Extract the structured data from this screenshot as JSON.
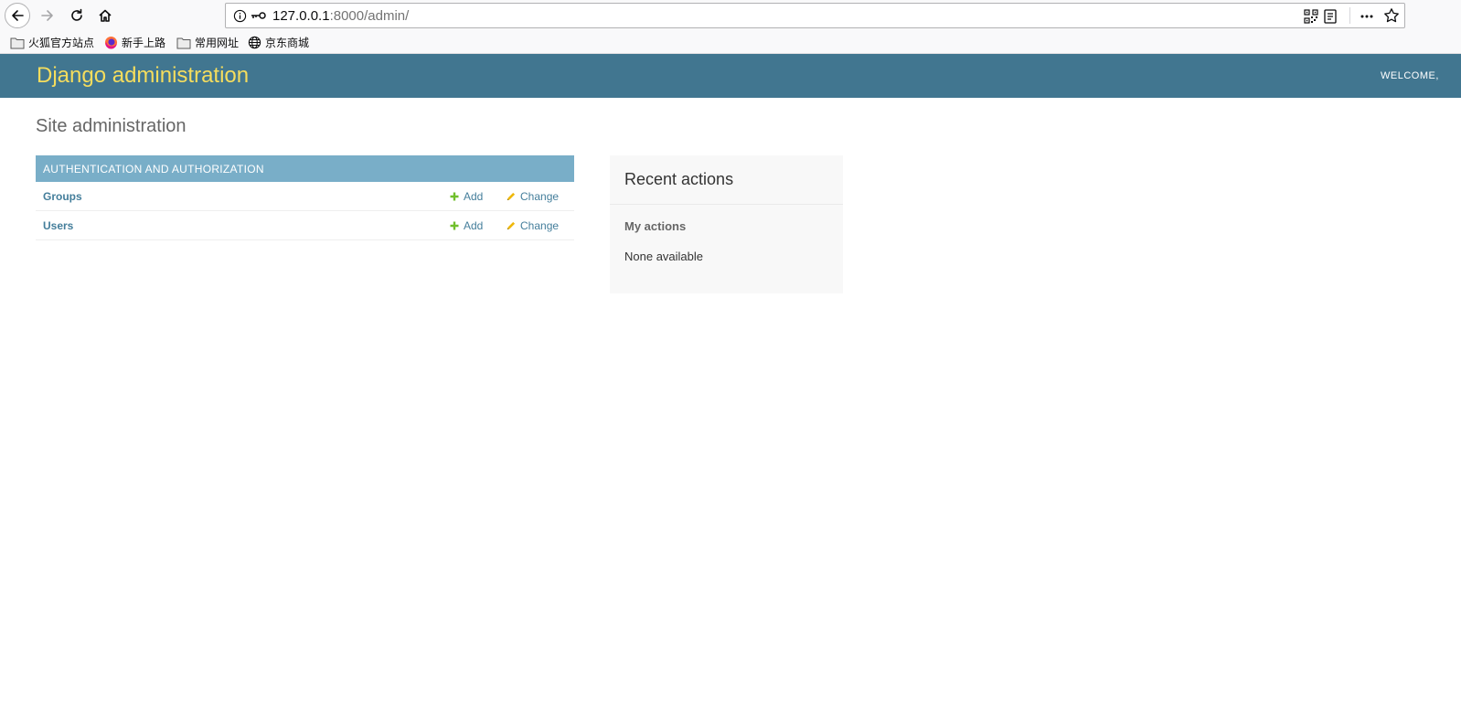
{
  "browser": {
    "url_host": "127.0.0.1",
    "url_rest": ":8000/admin/",
    "bookmarks": [
      {
        "label": "火狐官方站点",
        "icon": "folder-icon"
      },
      {
        "label": "新手上路",
        "icon": "firefox-icon"
      },
      {
        "label": "常用网址",
        "icon": "folder-icon"
      },
      {
        "label": "京东商城",
        "icon": "globe-icon"
      }
    ]
  },
  "header": {
    "brand": "Django administration",
    "user_tools": "WELCOME,",
    "background_color": "#417690",
    "brand_color": "#f5dd5d"
  },
  "page": {
    "title": "Site administration"
  },
  "app_module": {
    "caption": "AUTHENTICATION AND AUTHORIZATION",
    "caption_color": "#79aec8",
    "models": [
      {
        "name": "Groups",
        "add": "Add",
        "change": "Change"
      },
      {
        "name": "Users",
        "add": "Add",
        "change": "Change"
      }
    ]
  },
  "recent_actions": {
    "title": "Recent actions",
    "subtitle": "My actions",
    "empty_text": "None available"
  }
}
